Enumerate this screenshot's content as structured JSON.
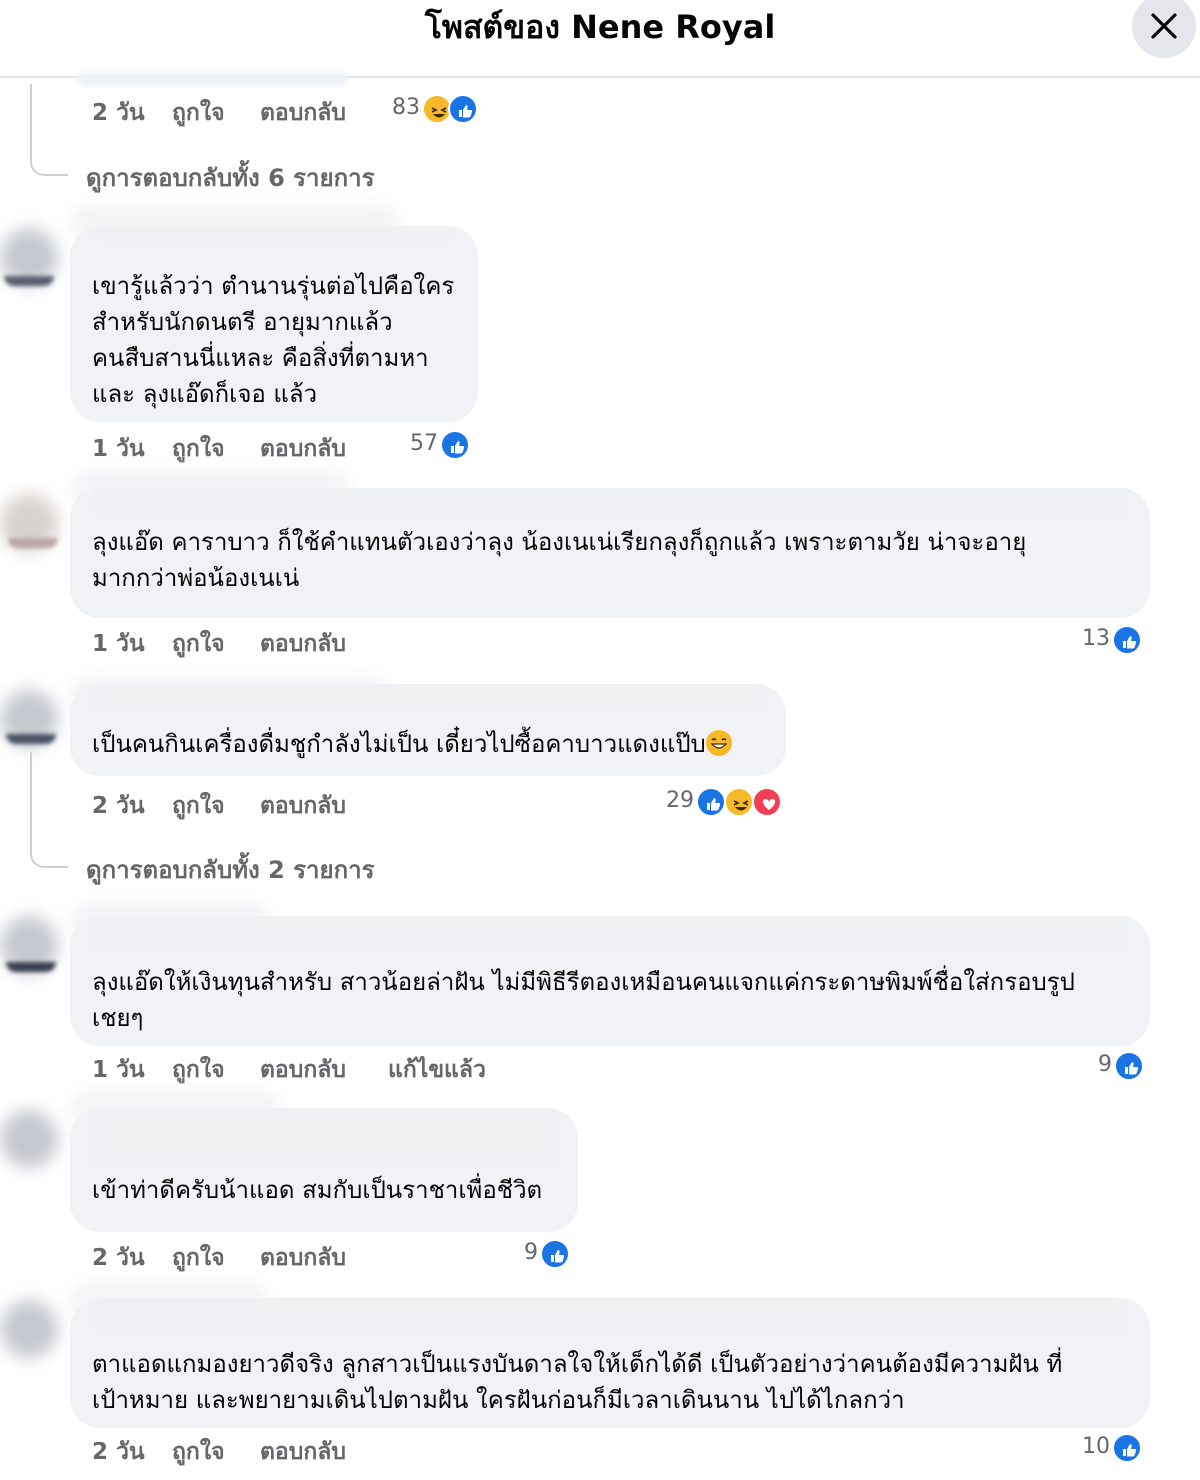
{
  "header": {
    "title": "โพสต์ของ Nene Royal"
  },
  "comments": [
    {
      "time": "2 วัน",
      "like": "ถูกใจ",
      "reply": "ตอบกลับ",
      "count": "83"
    },
    {
      "view_replies": "ดูการตอบกลับทั้ง 6 รายการ"
    },
    {
      "text": "เขารู้แล้วว่า ตำนานรุ่นต่อไปคือใคร\nสำหรับนักดนตรี อายุมากแล้ว\nคนสืบสานนี่แหละ คือสิ่งที่ตามหา\nและ ลุงแอ๊ดก็เจอ แล้ว",
      "time": "1 วัน",
      "like": "ถูกใจ",
      "reply": "ตอบกลับ",
      "count": "57"
    },
    {
      "text": "ลุงแอ๊ด คาราบาว ก็ใช้คำแทนตัวเองว่าลุง น้องเนเน่เรียกลุงก็ถูกแล้ว เพราะตามวัย น่าจะอายุ\nมากกว่าพ่อน้องเนเน่",
      "time": "1 วัน",
      "like": "ถูกใจ",
      "reply": "ตอบกลับ",
      "count": "13"
    },
    {
      "text": "เป็นคนกินเครื่องดื่มชูกำลังไม่เป็น เดี๋ยวไปซื้อคาบาวแดงแป๊บ",
      "time": "2 วัน",
      "like": "ถูกใจ",
      "reply": "ตอบกลับ",
      "count": "29",
      "view_replies": "ดูการตอบกลับทั้ง 2 รายการ"
    },
    {
      "text": "ลุงแอ๊ดให้เงินทุนสำหรับ สาวน้อยล่าฝัน ไม่มีพิธีรีตองเหมือนคนแจกแค่กระดาษพิมพ์ชื่อใส่กรอบรูป\nเชยๆ",
      "time": "1 วัน",
      "like": "ถูกใจ",
      "reply": "ตอบกลับ",
      "edited": "แก้ไขแล้ว",
      "count": "9"
    },
    {
      "text": "เข้าท่าดีครับน้าแอด สมกับเป็นราชาเพื่อชีวิต",
      "time": "2 วัน",
      "like": "ถูกใจ",
      "reply": "ตอบกลับ",
      "count": "9"
    },
    {
      "text": "ตาแอดแกมองยาวดีจริง ลูกสาวเป็นแรงบันดาลใจให้เด็กได้ดี เป็นตัวอย่างว่าคนต้องมีความฝัน ที่\nเป้าหมาย และพยายามเดินไปตามฝัน ใครฝันก่อนก็มีเวลาเดินนาน ไปได้ไกลกว่า",
      "time": "2 วัน",
      "like": "ถูกใจ",
      "reply": "ตอบกลับ",
      "count": "10"
    }
  ],
  "icons": {
    "close": "close-icon",
    "like": "like-reaction-icon",
    "haha": "haha-reaction-icon",
    "love": "love-reaction-icon"
  },
  "colors": {
    "like": "#1b74e4",
    "haha": "#f7b928",
    "love": "#f33e58",
    "meta": "#65676b",
    "bubble": "#f0f2f5"
  }
}
